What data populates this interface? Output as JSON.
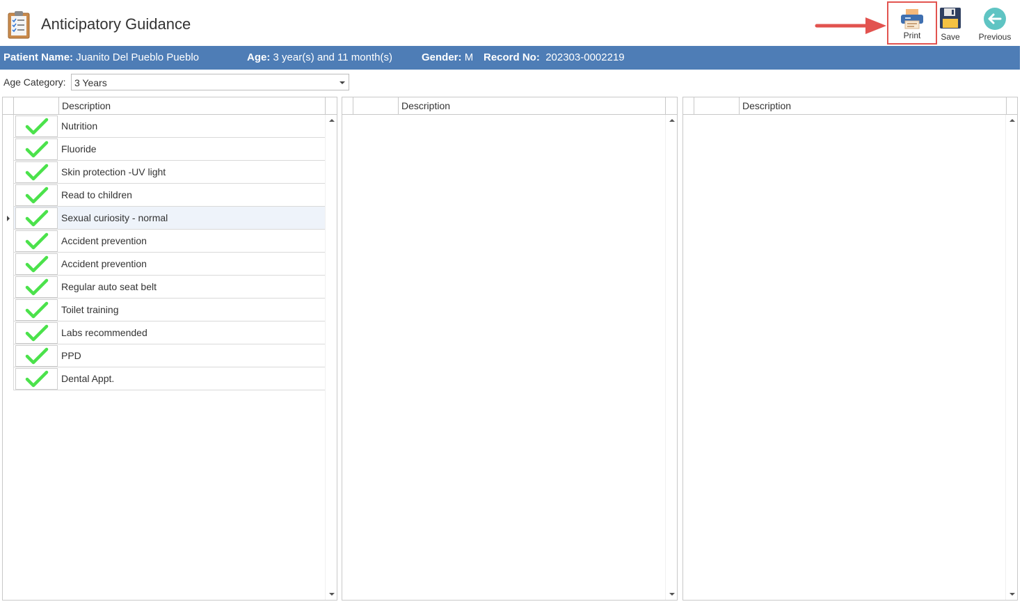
{
  "header": {
    "title": "Anticipatory Guidance",
    "app_icon": "clipboard-checklist-icon"
  },
  "toolbar": {
    "print_label": "Print",
    "save_label": "Save",
    "previous_label": "Previous",
    "highlight_color": "#e2534f"
  },
  "patient": {
    "name_label": "Patient Name:",
    "name_value": "Juanito Del Pueblo Pueblo",
    "age_label": "Age:",
    "age_value": "3 year(s) and 11 month(s)",
    "gender_label": "Gender:",
    "gender_value": "M",
    "record_label": "Record No:",
    "record_value": "202303-0002219",
    "bar_color": "#4e7db6"
  },
  "age_category": {
    "label": "Age Category:",
    "selected": "3 Years"
  },
  "grids": [
    {
      "header": "Description",
      "rows": [
        {
          "checked": true,
          "text": "Nutrition"
        },
        {
          "checked": true,
          "text": "Fluoride"
        },
        {
          "checked": true,
          "text": "Skin protection -UV light"
        },
        {
          "checked": true,
          "text": "Read to children"
        },
        {
          "checked": true,
          "text": "Sexual curiosity - normal",
          "selected": true
        },
        {
          "checked": true,
          "text": "Accident prevention"
        },
        {
          "checked": true,
          "text": "Accident prevention"
        },
        {
          "checked": true,
          "text": "Regular auto seat belt"
        },
        {
          "checked": true,
          "text": "Toilet training"
        },
        {
          "checked": true,
          "text": "Labs recommended"
        },
        {
          "checked": true,
          "text": "PPD"
        },
        {
          "checked": true,
          "text": "Dental Appt."
        }
      ]
    },
    {
      "header": "Description",
      "rows": []
    },
    {
      "header": "Description",
      "rows": []
    }
  ]
}
